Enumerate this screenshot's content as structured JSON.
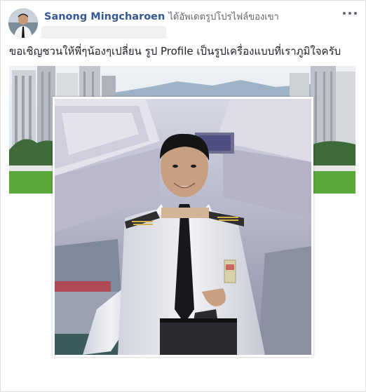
{
  "post": {
    "author_name": "Sanong Mingcharoen",
    "action_text": "ได้อัพเดตรูปโปรไฟล์ของเขา",
    "caption": "ขอเชิญชวนให้พี่ๆน้องๆเปลี่ยน รูป Profile เป็นรูปเครื่องแบบที่เราภูมิใจครับ",
    "more_icon": "more-horizontal-icon"
  },
  "colors": {
    "author_link": "#365899",
    "secondary_text": "#616770",
    "body_text": "#1d2129",
    "border": "#dddfe2"
  }
}
